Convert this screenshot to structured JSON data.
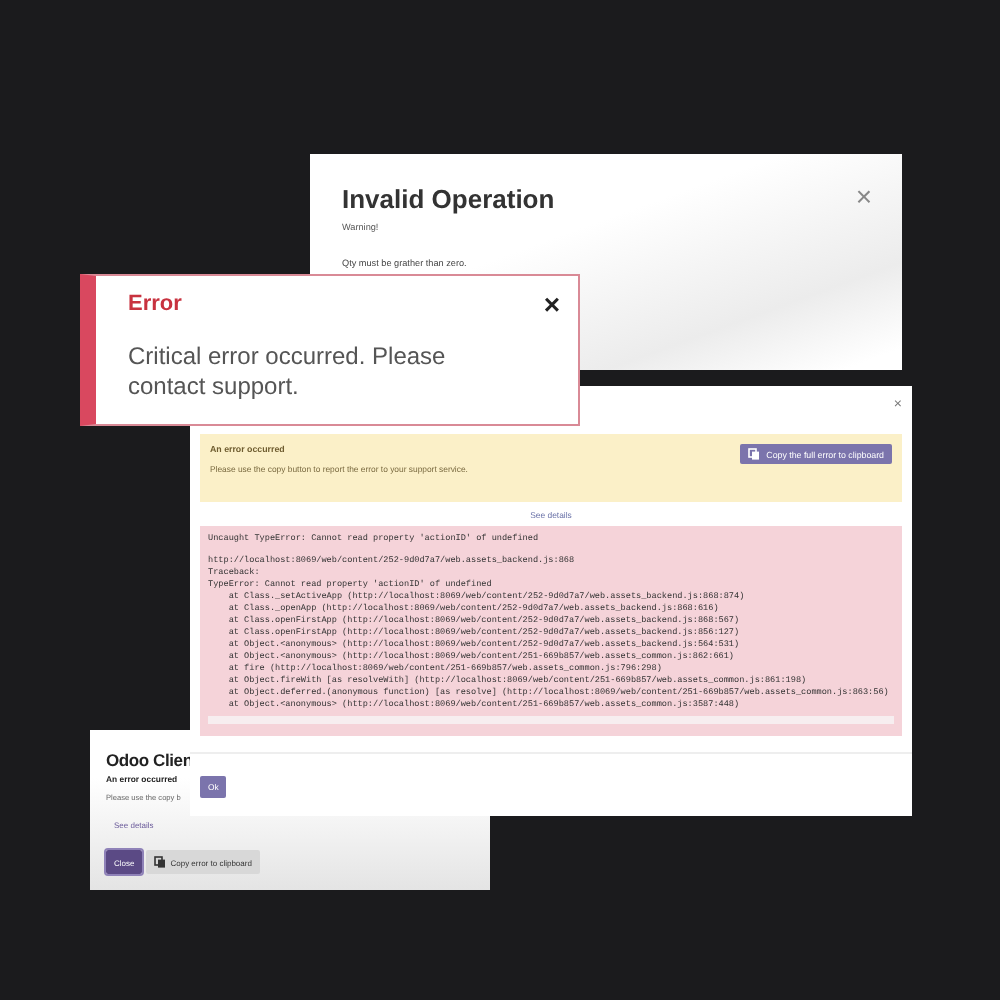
{
  "invalid_dialog": {
    "title": "Invalid Operation",
    "subtitle": "Warning!",
    "message": "Qty must be grather than zero.",
    "close": "×"
  },
  "client_dialog": {
    "title": "Odoo Clien",
    "subtitle": "An error occurred",
    "message": "Please use the copy b",
    "details_link": "See details",
    "buttons": [
      {
        "label": "Close",
        "kind": "primary"
      },
      {
        "label": "Copy error to clipboard",
        "kind": "secondary"
      }
    ]
  },
  "error_dialog": {
    "close": "×",
    "alert_title": "An error occurred",
    "alert_message": "Please use the copy button to report the error to your support service.",
    "copy_button": "Copy the full error to clipboard",
    "details_link": "See details",
    "summary": "Uncaught TypeError: Cannot read property 'actionID' of undefined",
    "trace": [
      "http://localhost:8069/web/content/252-9d0d7a7/web.assets_backend.js:868",
      "Traceback:",
      "TypeError: Cannot read property 'actionID' of undefined",
      "    at Class._setActiveApp (http://localhost:8069/web/content/252-9d0d7a7/web.assets_backend.js:868:874)",
      "    at Class._openApp (http://localhost:8069/web/content/252-9d0d7a7/web.assets_backend.js:868:616)",
      "    at Class.openFirstApp (http://localhost:8069/web/content/252-9d0d7a7/web.assets_backend.js:868:567)",
      "    at Class.openFirstApp (http://localhost:8069/web/content/252-9d0d7a7/web.assets_backend.js:856:127)",
      "    at Object.<anonymous> (http://localhost:8069/web/content/252-9d0d7a7/web.assets_backend.js:564:531)",
      "    at Object.<anonymous> (http://localhost:8069/web/content/251-669b857/web.assets_common.js:862:661)",
      "    at fire (http://localhost:8069/web/content/251-669b857/web.assets_common.js:796:298)",
      "    at Object.fireWith [as resolveWith] (http://localhost:8069/web/content/251-669b857/web.assets_common.js:861:198)",
      "    at Object.deferred.(anonymous function) [as resolve] (http://localhost:8069/web/content/251-669b857/web.assets_common.js:863:56)",
      "    at Object.<anonymous> (http://localhost:8069/web/content/251-669b857/web.assets_common.js:3587:448)"
    ],
    "ok_button": "Ok"
  },
  "toast": {
    "title": "Error",
    "message": "Critical error occurred. Please contact support.",
    "close": "×"
  }
}
